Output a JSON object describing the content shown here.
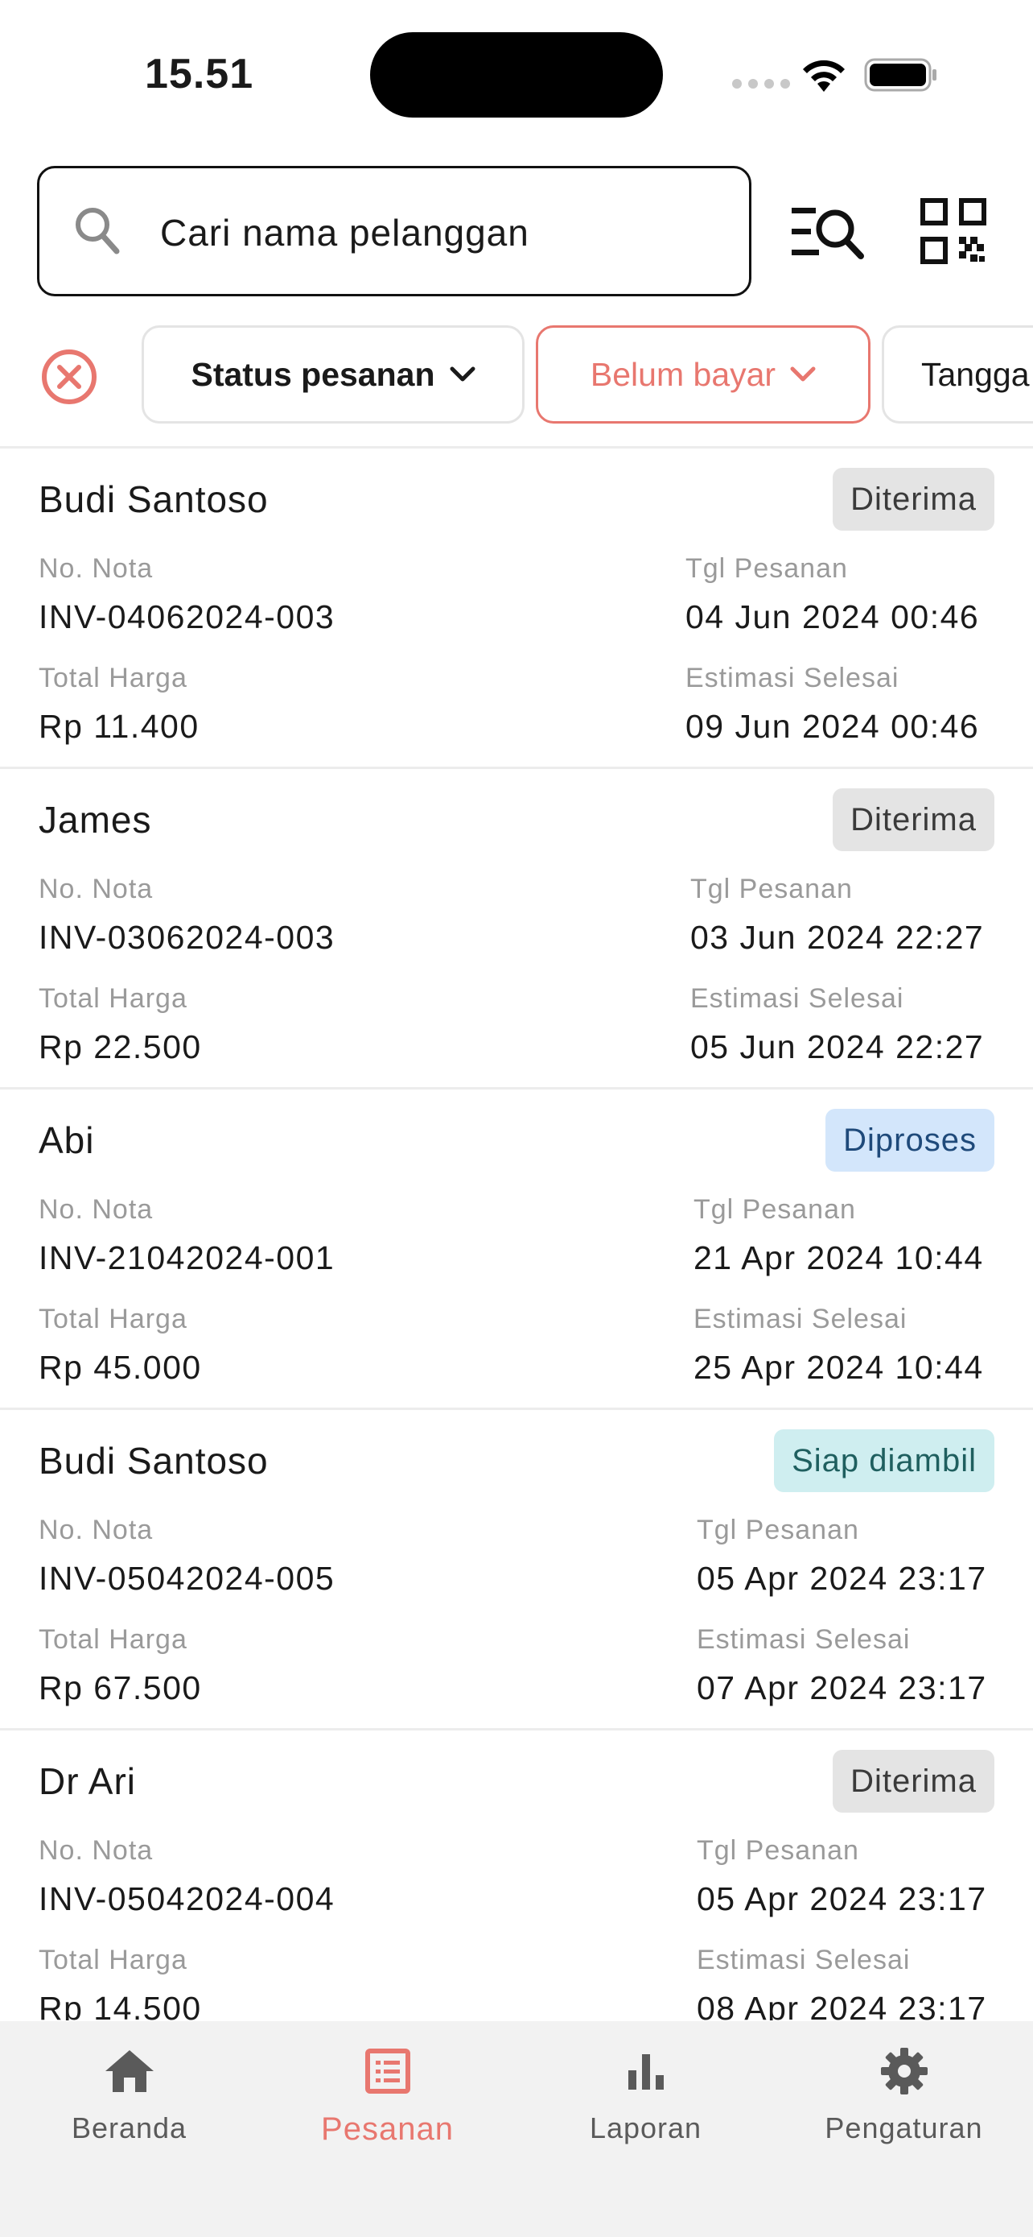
{
  "status_bar": {
    "time": "15.51"
  },
  "search": {
    "placeholder": "Cari nama pelanggan"
  },
  "filters": {
    "status": "Status pesanan",
    "payment": "Belum bayar",
    "date": "Tangga"
  },
  "orders": [
    {
      "name": "Budi Santoso",
      "status": "Diterima",
      "nota_label": "No. Nota",
      "nota": "INV-04062024-003",
      "tgl_label": "Tgl Pesanan",
      "tgl": "04 Jun 2024 00:46",
      "total_label": "Total Harga",
      "total": "Rp 11.400",
      "est_label": "Estimasi Selesai",
      "est": "09 Jun 2024 00:46"
    },
    {
      "name": "James",
      "status": "Diterima",
      "nota_label": "No. Nota",
      "nota": "INV-03062024-003",
      "tgl_label": "Tgl Pesanan",
      "tgl": "03 Jun 2024 22:27",
      "total_label": "Total Harga",
      "total": "Rp 22.500",
      "est_label": "Estimasi Selesai",
      "est": "05 Jun 2024 22:27"
    },
    {
      "name": "Abi",
      "status": "Diproses",
      "nota_label": "No. Nota",
      "nota": "INV-21042024-001",
      "tgl_label": "Tgl Pesanan",
      "tgl": "21 Apr 2024 10:44",
      "total_label": "Total Harga",
      "total": "Rp 45.000",
      "est_label": "Estimasi Selesai",
      "est": "25 Apr 2024 10:44"
    },
    {
      "name": "Budi Santoso",
      "status": "Siap diambil",
      "nota_label": "No. Nota",
      "nota": "INV-05042024-005",
      "tgl_label": "Tgl Pesanan",
      "tgl": "05 Apr 2024 23:17",
      "total_label": "Total Harga",
      "total": "Rp 67.500",
      "est_label": "Estimasi Selesai",
      "est": "07 Apr 2024 23:17"
    },
    {
      "name": "Dr Ari",
      "status": "Diterima",
      "nota_label": "No. Nota",
      "nota": "INV-05042024-004",
      "tgl_label": "Tgl Pesanan",
      "tgl": "05 Apr 2024 23:17",
      "total_label": "Total Harga",
      "total": "Rp 14.500",
      "est_label": "Estimasi Selesai",
      "est": "08 Apr 2024 23:17"
    }
  ],
  "nav": {
    "home": "Beranda",
    "orders": "Pesanan",
    "reports": "Laporan",
    "settings": "Pengaturan"
  },
  "colors": {
    "accent": "#e8776f",
    "badge_diterima": "#e4e4e4",
    "badge_diproses": "#d3e6fb",
    "badge_siap": "#cfeef0"
  }
}
